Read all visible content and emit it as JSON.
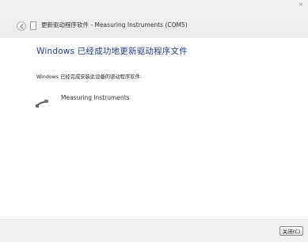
{
  "window": {
    "close_glyph": "×",
    "title": "更新驱动程序软件 - Measuring Instruments (COM5)"
  },
  "main": {
    "heading": "Windows 已经成功地更新驱动程序文件",
    "subtext": "Windows 已经完成安装此设备的驱动程序软件:",
    "device_name": "Measuring Instruments",
    "device_icon": "usb-cable-icon"
  },
  "footer": {
    "close_label": "关闭(C)"
  },
  "colors": {
    "heading": "#1e3a8a",
    "footer_bg": "#f0f0f0"
  }
}
